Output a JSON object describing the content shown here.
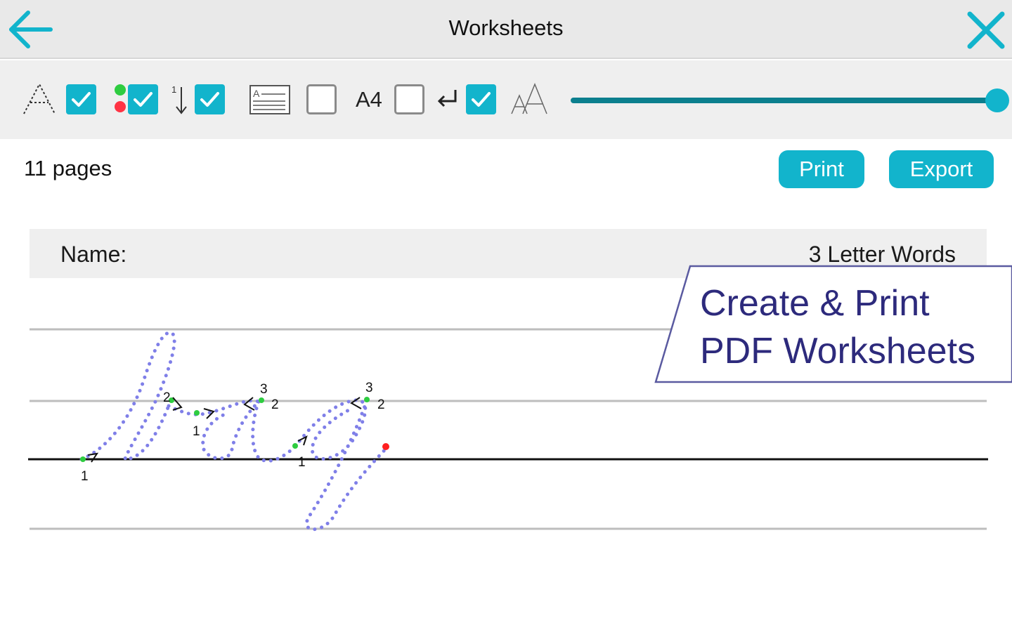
{
  "header": {
    "title": "Worksheets",
    "back_icon": "arrow-left-icon",
    "close_icon": "close-icon",
    "accent_color": "#12b4cc"
  },
  "toolbar": {
    "items": [
      {
        "icon": "dotted-letter-icon",
        "checked": true
      },
      {
        "icon": "start-end-dots-icon",
        "checked": true
      },
      {
        "icon": "stroke-order-arrow-icon",
        "checked": true
      },
      {
        "icon": "page-layout-icon",
        "checked": false
      },
      {
        "icon": "paper-size-label",
        "label": "A4",
        "checked": false
      },
      {
        "icon": "line-return-icon",
        "checked": true
      },
      {
        "icon": "font-size-icon"
      }
    ],
    "size_slider": {
      "value": 1.0
    }
  },
  "info": {
    "pages": "11 pages",
    "print_label": "Print",
    "export_label": "Export"
  },
  "worksheet": {
    "name_label": "Name:",
    "title": "3 Letter Words",
    "stroke_numbers": [
      "1",
      "2",
      "1",
      "3",
      "2",
      "1",
      "3",
      "2"
    ],
    "trace_color": "#7f7fe8"
  },
  "banner": {
    "line1": "Create & Print",
    "line2": "PDF Worksheets",
    "text_color": "#2d2a7c"
  }
}
